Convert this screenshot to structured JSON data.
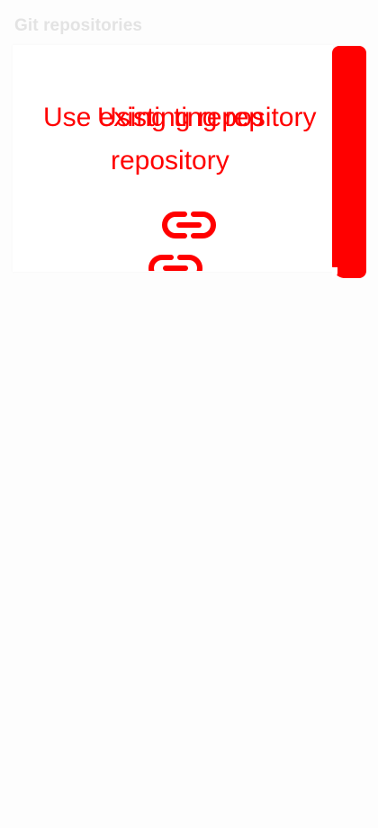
{
  "header": {
    "title": "Git repositories"
  },
  "actions": {
    "use_existing_label": "Use existing repository",
    "using_label_overlap": "Using ting rep",
    "repository_label": "repository"
  },
  "icons": {
    "link_icon_name": "link-icon"
  },
  "colors": {
    "accent": "#ff0000",
    "title": "#e3e3e3",
    "background": "#fdfdfd"
  }
}
